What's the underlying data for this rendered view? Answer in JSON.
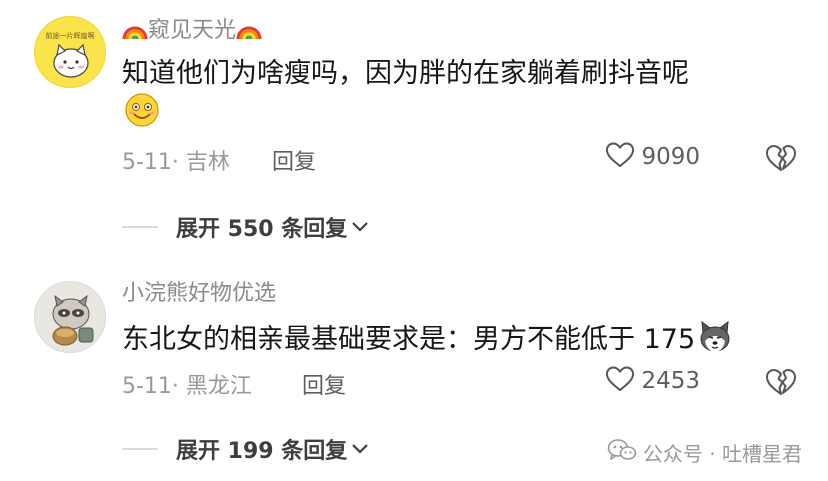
{
  "comments": [
    {
      "avatar_caption": "前途一片辉煌啊",
      "username": "窥见天光",
      "content": "知道他们为啥瘦吗，因为胖的在家躺着刷抖音呢",
      "date_location": "5-11· 吉林",
      "reply_label": "回复",
      "like_count": "9090",
      "expand_label": "展开 550 条回复"
    },
    {
      "username": "小浣熊好物优选",
      "content": "东北女的相亲最基础要求是：男方不能低于 175",
      "date_location": "5-11· 黑龙江",
      "reply_label": "回复",
      "like_count": "2453",
      "expand_label": "展开 199 条回复"
    }
  ],
  "watermark": {
    "text": "公众号 · 吐槽星君"
  },
  "icons": {
    "rainbow": "rainbow-icon",
    "emoji_smile": "smiling-face-icon",
    "husky": "husky-dog-icon",
    "like": "heart-outline-icon",
    "dislike": "broken-heart-icon",
    "expand": "chevron-down-icon",
    "wechat": "wechat-icon"
  },
  "colors": {
    "text_primary": "#161616",
    "text_secondary": "#8a8a8a",
    "avatar_yellow": "#fbe34a"
  }
}
